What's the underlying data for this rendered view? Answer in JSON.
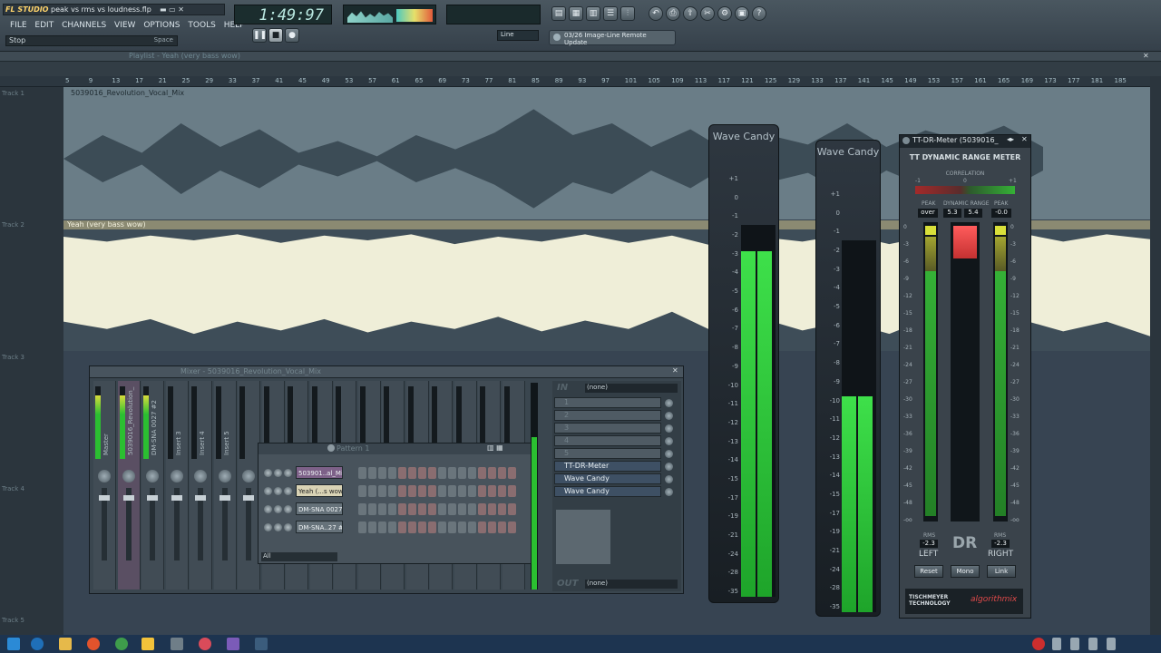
{
  "app": {
    "logo": "FL STUDIO",
    "project_file": "peak vs rms vs loudness.flp",
    "menu": [
      "FILE",
      "EDIT",
      "CHANNELS",
      "VIEW",
      "OPTIONS",
      "TOOLS",
      "HELP"
    ],
    "status_left": "Stop",
    "status_right": "Space",
    "time_display": "1:49:97",
    "news_ticker": "03/26 Image-Line Remote Update",
    "snap_label": "Line"
  },
  "playlist": {
    "title": "Playlist - Yeah (very bass wow)",
    "ruler_ticks": [
      "5",
      "9",
      "13",
      "17",
      "21",
      "25",
      "29",
      "33",
      "37",
      "41",
      "45",
      "49",
      "53",
      "57",
      "61",
      "65",
      "69",
      "73",
      "77",
      "81",
      "85",
      "89",
      "93",
      "97",
      "101",
      "105",
      "109",
      "113",
      "117",
      "121",
      "125",
      "129",
      "133",
      "137",
      "141",
      "145",
      "149",
      "153",
      "157",
      "161",
      "165",
      "169",
      "173",
      "177",
      "181",
      "185"
    ],
    "tracks": [
      "Track 1",
      "Track 2",
      "Track 3",
      "Track 4",
      "Track 5"
    ],
    "clip1": "5039016_Revolution_Vocal_Mix",
    "clip2": "Yeah (very bass wow)"
  },
  "wave_candy_1": {
    "title": "Wave Candy",
    "scale": [
      "+1",
      "0",
      "-1",
      "-2",
      "-3",
      "-4",
      "-5",
      "-6",
      "-7",
      "-8",
      "-9",
      "-10",
      "-11",
      "-12",
      "-13",
      "-14",
      "-15",
      "-17",
      "-19",
      "-21",
      "-24",
      "-28",
      "-35"
    ],
    "level_fraction": 0.93
  },
  "wave_candy_2": {
    "title": "Wave Candy",
    "scale": [
      "+1",
      "0",
      "-1",
      "-2",
      "-3",
      "-4",
      "-5",
      "-6",
      "-7",
      "-8",
      "-9",
      "-10",
      "-11",
      "-12",
      "-13",
      "-14",
      "-15",
      "-17",
      "-19",
      "-21",
      "-24",
      "-28",
      "-35"
    ],
    "level_fraction": 0.58
  },
  "tt_meter": {
    "window_title": "TT-DR-Meter (5039016_",
    "heading": "TT DYNAMIC RANGE METER",
    "correlation_label": "CORRELATION",
    "corr_marks": [
      "-1",
      "0",
      "+1"
    ],
    "peak_label": "PEAK",
    "dr_label": "DYNAMIC RANGE",
    "peak_left": "over",
    "dr_left": "5.3",
    "dr_right": "5.4",
    "peak_right": "-0.0",
    "scale": [
      "0",
      "-3",
      "-6",
      "-9",
      "-12",
      "-15",
      "-18",
      "-21",
      "-24",
      "-27",
      "-30",
      "-33",
      "-36",
      "-39",
      "-42",
      "-45",
      "-48",
      "-oo"
    ],
    "rms_label": "RMS",
    "rms_left": "-2.3",
    "rms_right": "-2.3",
    "left_label": "LEFT",
    "right_label": "RIGHT",
    "dr_logo": "DR",
    "buttons": [
      "Reset",
      "Mono",
      "Link"
    ],
    "brand1": "TISCHMEYER TECHNOLOGY",
    "brand2": "algorithmix"
  },
  "mixer": {
    "title": "Mixer - 5039016_Revolution_Vocal_Mix",
    "channels": [
      "Master",
      "5039016_Revolution_",
      "DM-SNA 0027 #2",
      "Insert 3",
      "Insert 4",
      "Insert 5"
    ],
    "in_label": "IN",
    "in_value": "(none)",
    "slots": [
      "1",
      "2",
      "3",
      "4",
      "5"
    ],
    "effects": [
      "TT-DR-Meter",
      "Wave Candy",
      "Wave Candy"
    ],
    "out_label": "OUT",
    "out_value": "(none)"
  },
  "pattern": {
    "title": "Pattern 1",
    "channels": [
      "503901..al_Mix",
      "Yeah (...s wow)",
      "DM-SNA 0027",
      "DM-SNA..27 #2"
    ],
    "filter": "All"
  },
  "colors": {
    "meter_green": "#27c42b",
    "meter_red": "#e23a3a",
    "clip_cream": "#efeed8",
    "accent_orange": "#f0a23a"
  }
}
